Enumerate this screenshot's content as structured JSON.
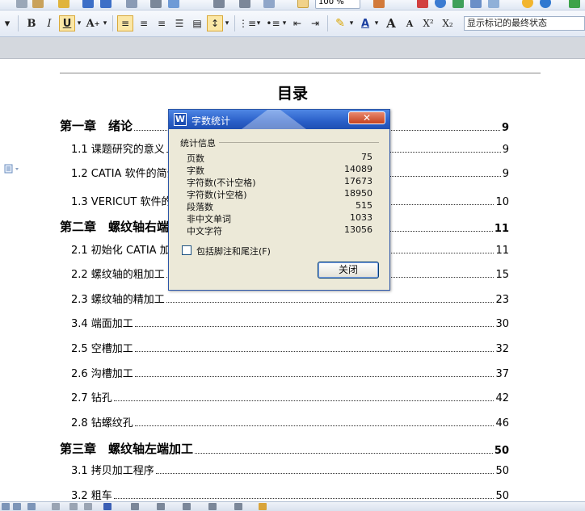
{
  "toolbar": {
    "zoom": "100 %",
    "bold": "B",
    "italic": "I",
    "underline": "U",
    "font_color": "A",
    "font_grow": "A",
    "font_shrink": "A",
    "superscript": "X²",
    "subscript": "X₂",
    "style_select": "显示标记的最终状态"
  },
  "document": {
    "toc_title": "目录",
    "entries": [
      {
        "text": "第一章　绪论",
        "page": "9"
      },
      {
        "text": "1.1  课题研究的意义",
        "page": "9"
      },
      {
        "text": "1.2 CATIA 软件的简介",
        "page": "9"
      },
      {
        "text": "1.3 VERICUT 软件的简介",
        "page": "10"
      },
      {
        "text": "第二章　螺纹轴右端加工",
        "page": "11"
      },
      {
        "text": "2.1 初始化 CATIA 加工环境",
        "page": "11"
      },
      {
        "text": "2.2  螺纹轴的粗加工",
        "page": "15"
      },
      {
        "text": "2.3  螺纹轴的精加工",
        "page": "23"
      },
      {
        "text": "3.4  端面加工",
        "page": "30"
      },
      {
        "text": "2.5  空槽加工",
        "page": "32"
      },
      {
        "text": "2.6 沟槽加工",
        "page": "37"
      },
      {
        "text": "2.7  钻孔",
        "page": "42"
      },
      {
        "text": "2.8 钻螺纹孔",
        "page": "46"
      },
      {
        "text": "第三章　螺纹轴左端加工",
        "page": "50"
      },
      {
        "text": "3.1  拷贝加工程序",
        "page": "50"
      },
      {
        "text": "3.2 粗车",
        "page": "50"
      }
    ]
  },
  "dialog": {
    "logo": "W",
    "title": "字数统计",
    "close_glyph": "✕",
    "group_label": "统计信息",
    "stats": [
      {
        "label": "页数",
        "value": "75"
      },
      {
        "label": "字数",
        "value": "14089"
      },
      {
        "label": "字符数(不计空格)",
        "value": "17673"
      },
      {
        "label": "字符数(计空格)",
        "value": "18950"
      },
      {
        "label": "段落数",
        "value": "515"
      },
      {
        "label": "非中文单词",
        "value": "1033"
      },
      {
        "label": "中文字符",
        "value": "13056"
      }
    ],
    "checkbox_label": "包括脚注和尾注(F)",
    "close_button": "关闭"
  },
  "colors": {
    "title_bar": "#2a5fc8",
    "dialog_bg": "#ece9d8",
    "close_btn": "#c5411d",
    "watermark": "#4fa3e6"
  }
}
